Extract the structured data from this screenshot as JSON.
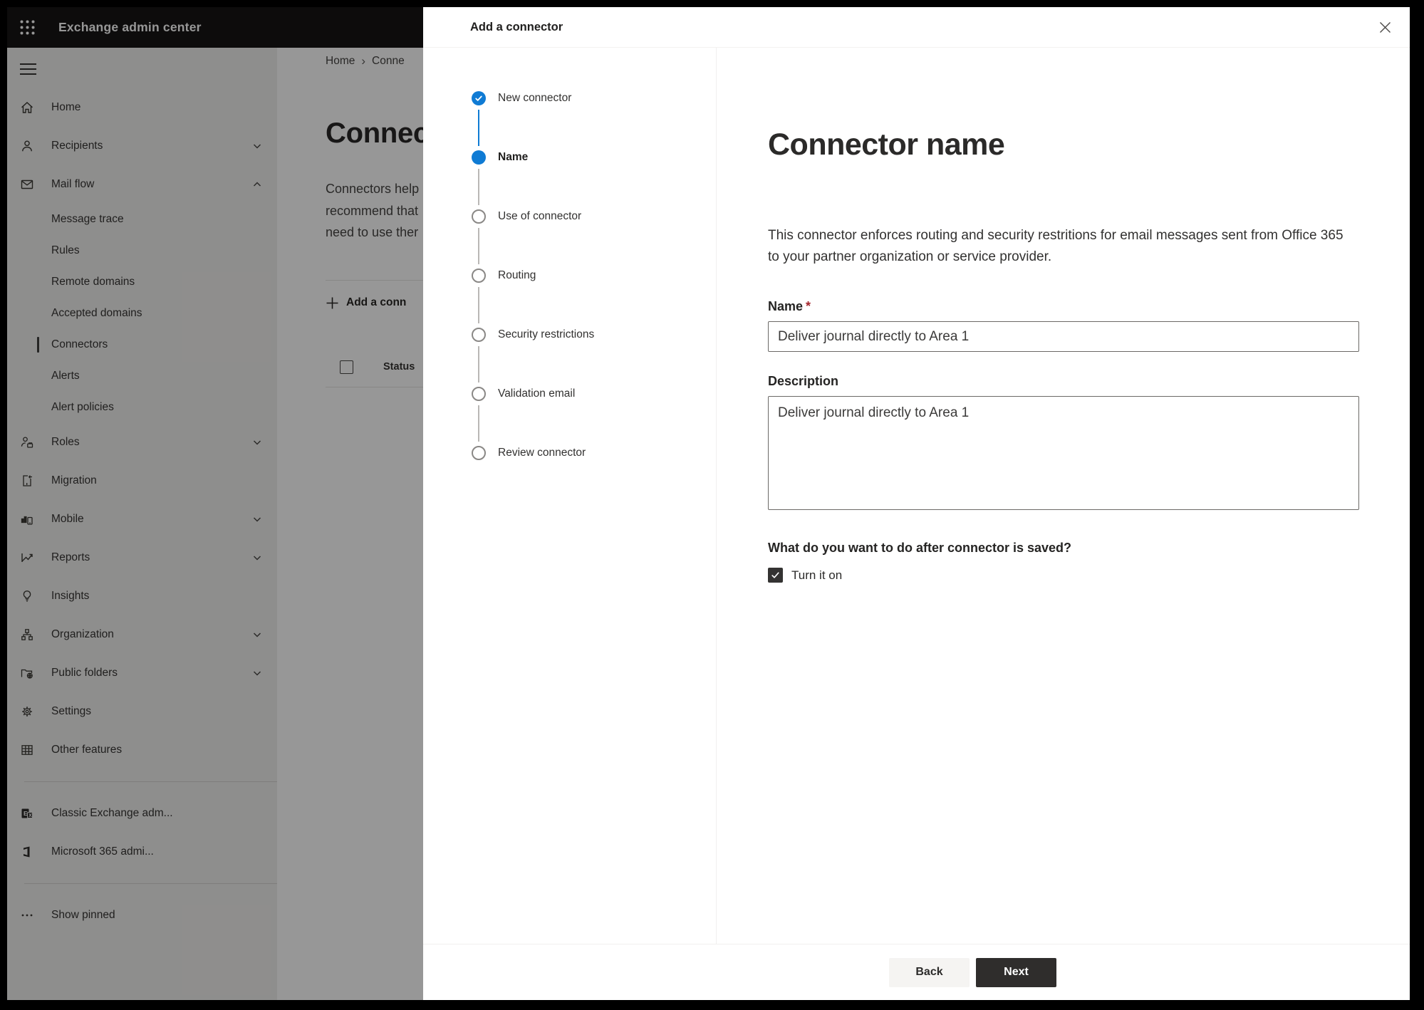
{
  "topbar": {
    "title": "Exchange admin center"
  },
  "sidebar": {
    "items": [
      {
        "label": "Home"
      },
      {
        "label": "Recipients"
      },
      {
        "label": "Mail flow"
      },
      {
        "label": "Message trace"
      },
      {
        "label": "Rules"
      },
      {
        "label": "Remote domains"
      },
      {
        "label": "Accepted domains"
      },
      {
        "label": "Connectors",
        "selected": true
      },
      {
        "label": "Alerts"
      },
      {
        "label": "Alert policies"
      },
      {
        "label": "Roles"
      },
      {
        "label": "Migration"
      },
      {
        "label": "Mobile"
      },
      {
        "label": "Reports"
      },
      {
        "label": "Insights"
      },
      {
        "label": "Organization"
      },
      {
        "label": "Public folders"
      },
      {
        "label": "Settings"
      },
      {
        "label": "Other features"
      },
      {
        "label": "Classic Exchange adm..."
      },
      {
        "label": "Microsoft 365 admi..."
      },
      {
        "label": "Show pinned"
      }
    ]
  },
  "page": {
    "breadcrumb": {
      "home": "Home",
      "sep": "›",
      "current": "Conne"
    },
    "title": "Connec",
    "intro_lines": [
      "Connectors help",
      "recommend that",
      "need to use ther"
    ],
    "add_button": "Add a conn",
    "table": {
      "status_header": "Status"
    }
  },
  "dialog": {
    "title": "Add a connector",
    "steps": [
      {
        "label": "New connector",
        "state": "done"
      },
      {
        "label": "Name",
        "state": "current"
      },
      {
        "label": "Use of connector",
        "state": "todo"
      },
      {
        "label": "Routing",
        "state": "todo"
      },
      {
        "label": "Security restrictions",
        "state": "todo"
      },
      {
        "label": "Validation email",
        "state": "todo"
      },
      {
        "label": "Review connector",
        "state": "todo"
      }
    ],
    "content": {
      "heading": "Connector name",
      "description": "This connector enforces routing and security restritions for email messages sent from Office 365 to your partner organization or service provider.",
      "name_label": "Name",
      "required_mark": "*",
      "name_value": "Deliver journal directly to Area 1",
      "description_label": "Description",
      "description_value": "Deliver journal directly to Area 1",
      "question": "What do you want to do after connector is saved?",
      "checkbox_label": "Turn it on",
      "checkbox_checked": true
    },
    "footer": {
      "back": "Back",
      "next": "Next"
    }
  },
  "colors": {
    "accent": "#0f7bd4",
    "text": "#323130",
    "required": "#a4262c",
    "topbar": "#121110"
  }
}
